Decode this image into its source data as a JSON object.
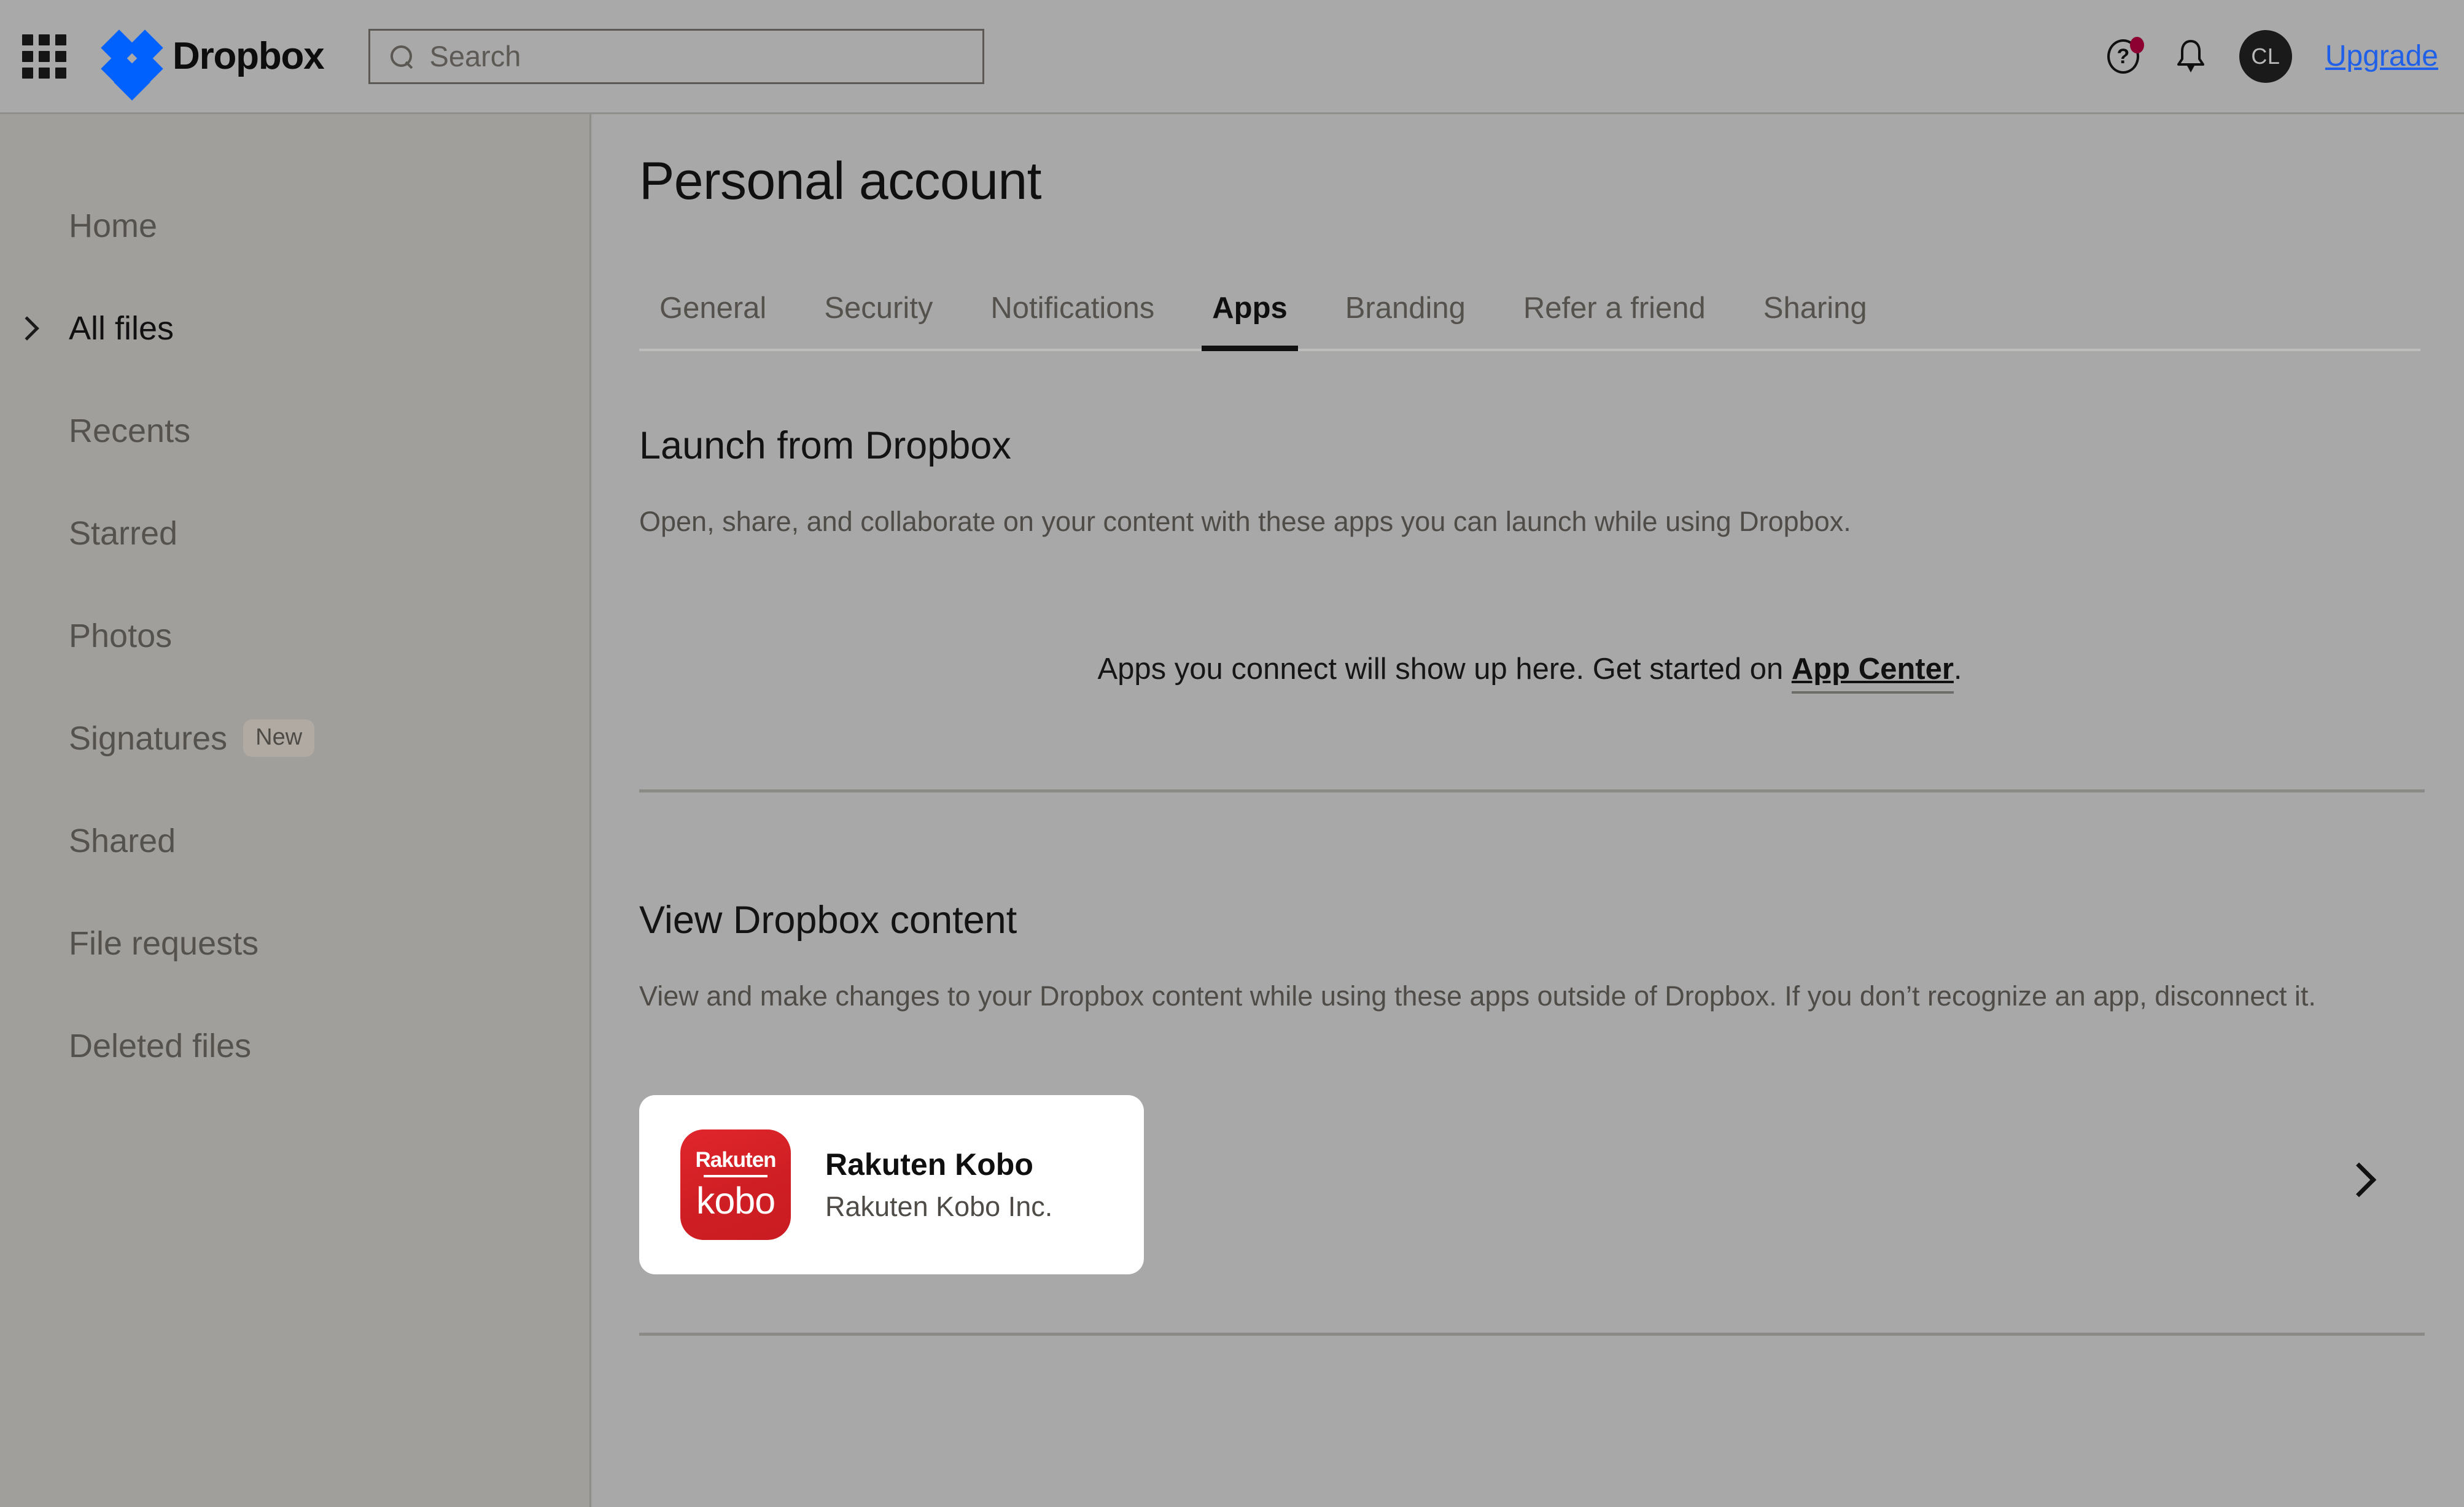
{
  "header": {
    "grid_icon": "apps-grid-icon",
    "brand_name": "Dropbox",
    "search": {
      "icon": "search-icon",
      "placeholder": "Search",
      "value": ""
    },
    "help_icon": "help-question-icon",
    "help_icon_glyph": "?",
    "notifications_icon": "bell-icon",
    "avatar_initials": "CL",
    "upgrade_label": "Upgrade",
    "upgrade_color": "#2060e8",
    "brand_color": "#0061ff",
    "notification_dot_color": "#8c0032"
  },
  "sidebar": {
    "items": [
      {
        "label": "Home",
        "active": false,
        "chevron": false,
        "badge": null
      },
      {
        "label": "All files",
        "active": true,
        "chevron": true,
        "badge": null
      },
      {
        "label": "Recents",
        "active": false,
        "chevron": false,
        "badge": null
      },
      {
        "label": "Starred",
        "active": false,
        "chevron": false,
        "badge": null
      },
      {
        "label": "Photos",
        "active": false,
        "chevron": false,
        "badge": null
      },
      {
        "label": "Signatures",
        "active": false,
        "chevron": false,
        "badge": "New"
      },
      {
        "label": "Shared",
        "active": false,
        "chevron": false,
        "badge": null
      },
      {
        "label": "File requests",
        "active": false,
        "chevron": false,
        "badge": null
      },
      {
        "label": "Deleted files",
        "active": false,
        "chevron": false,
        "badge": null
      }
    ]
  },
  "main": {
    "page_title": "Personal account",
    "tabs": [
      {
        "label": "General",
        "active": false
      },
      {
        "label": "Security",
        "active": false
      },
      {
        "label": "Notifications",
        "active": false
      },
      {
        "label": "Apps",
        "active": true
      },
      {
        "label": "Branding",
        "active": false
      },
      {
        "label": "Refer a friend",
        "active": false
      },
      {
        "label": "Sharing",
        "active": false
      }
    ],
    "launch_section": {
      "title": "Launch from Dropbox",
      "description": "Open, share, and collaborate on your content with these apps you can launch while using Dropbox.",
      "empty_prefix": "Apps you connect will show up here. Get started on ",
      "empty_link": "App Center",
      "empty_suffix": "."
    },
    "view_section": {
      "title": "View Dropbox content",
      "description": "View and make changes to your Dropbox content while using these apps outside of Dropbox. If you don’t recognize an app, disconnect it.",
      "apps": [
        {
          "name": "Rakuten Kobo",
          "publisher": "Rakuten Kobo Inc.",
          "logo_top": "Rakuten",
          "logo_bottom": "kobo",
          "logo_color": "#cf1f24",
          "chevron_icon": "chevron-right-icon"
        }
      ]
    }
  }
}
